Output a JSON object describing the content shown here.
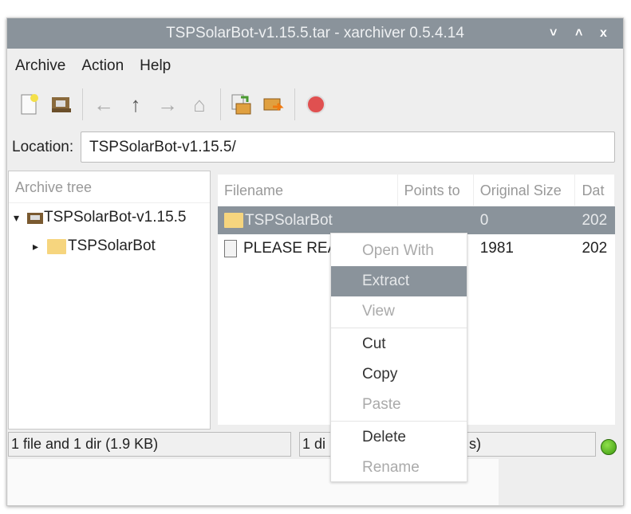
{
  "window": {
    "title": "TSPSolarBot-v1.15.5.tar - xarchiver 0.5.4.14",
    "minimize": "˅",
    "maximize": "˄",
    "close": "x"
  },
  "menu": [
    "Archive",
    "Action",
    "Help"
  ],
  "toolbar": {
    "new": "new-archive",
    "open": "open-archive",
    "back": "←",
    "up": "↑",
    "forward": "→",
    "home": "⌂",
    "add": "add",
    "extract": "extract",
    "stop": "stop"
  },
  "location": {
    "label": "Location:",
    "value": "TSPSolarBot-v1.15.5/"
  },
  "tree": {
    "header": "Archive tree",
    "root": "TSPSolarBot-v1.15.5",
    "child": "TSPSolarBot",
    "expanded_arrow": "▾",
    "collapsed_arrow": "▸"
  },
  "list": {
    "columns": [
      "Filename",
      "Points to",
      "Original Size",
      "Dat"
    ],
    "rows": [
      {
        "name": "TSPSolarBot",
        "points_to": "",
        "size": "0",
        "date": "202"
      },
      {
        "name": "PLEASE REA",
        "points_to": "",
        "size": "1981",
        "date": "202"
      }
    ]
  },
  "status": {
    "left": "1 file and 1 dir  (1.9 KB)",
    "right_start": "1 di",
    "right_end": "s)"
  },
  "context_menu": [
    {
      "label": "Open With",
      "enabled": false
    },
    {
      "label": "Extract",
      "enabled": true,
      "highlighted": true
    },
    {
      "label": "View",
      "enabled": false
    },
    {
      "label": "Cut",
      "enabled": true
    },
    {
      "label": "Copy",
      "enabled": true
    },
    {
      "label": "Paste",
      "enabled": false
    },
    {
      "label": "Delete",
      "enabled": true
    },
    {
      "label": "Rename",
      "enabled": false
    }
  ],
  "colors": {
    "titlebar": "#8a939b",
    "led": "#4caf20"
  }
}
